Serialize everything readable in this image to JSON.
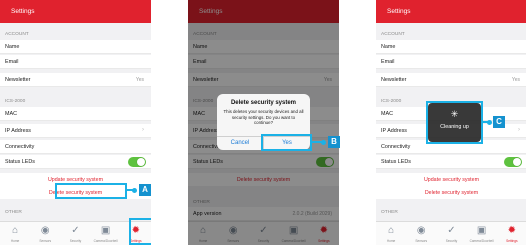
{
  "colors": {
    "brand_red": "#e0222e",
    "callout_blue": "#1bb1e6",
    "toggle_green": "#5ec23f"
  },
  "header_title": "Settings",
  "section_account": "ACCOUNT",
  "row_name": "Name",
  "row_email": "Email",
  "row_newsletter": "Newsletter",
  "newsletter_value": "Yes",
  "section_ics": "ICS-2000",
  "row_mac": "MAC",
  "row_ip": "IP Address",
  "row_connectivity": "Connectivity",
  "row_status_leds": "Status LEDs",
  "status_leds_on": true,
  "update_link": "Update security system",
  "delete_link": "Delete security system",
  "section_other": "OTHER",
  "row_app_version": "App version",
  "app_version_value": "2.0.2 (Build 2029)",
  "tabs": [
    {
      "label": "Home",
      "icon": "home-icon"
    },
    {
      "label": "Sensors",
      "icon": "play-circle-icon"
    },
    {
      "label": "Security",
      "icon": "shield-check-icon"
    },
    {
      "label": "Camera/Doorbell",
      "icon": "camera-icon"
    },
    {
      "label": "Settings",
      "icon": "gear-icon"
    }
  ],
  "dialog": {
    "title": "Delete security system",
    "message": "This deletes your security devices and all security settings. Do you want to continue?",
    "cancel": "Cancel",
    "confirm": "Yes"
  },
  "progress_text": "Cleaning up",
  "callouts": {
    "a": "A",
    "b": "B",
    "c": "C"
  }
}
